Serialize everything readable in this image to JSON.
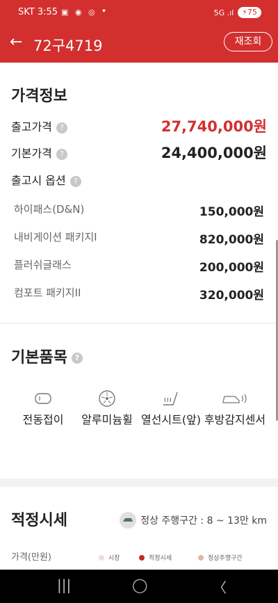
{
  "status": {
    "time": "SKT 3:55",
    "icons": "▣ ◉ ◎",
    "right": "5G .ıl",
    "battery": "75"
  },
  "appbar": {
    "back": "←",
    "title": "72구4719",
    "reload": "재조회"
  },
  "price_info": {
    "heading": "가격정보",
    "release_label": "출고가격",
    "release_value": "27,740,000원",
    "base_label": "기본가격",
    "base_value": "24,400,000원",
    "options_label": "출고시 옵션",
    "options": [
      {
        "label": "하이패스(D&N)",
        "value": "150,000원"
      },
      {
        "label": "내비게이션 패키지I",
        "value": "820,000원"
      },
      {
        "label": "플러쉬글래스",
        "value": "200,000원"
      },
      {
        "label": "컴포트 패키지II",
        "value": "320,000원"
      }
    ]
  },
  "basic_items": {
    "heading": "기본품목",
    "items": [
      {
        "label": "전동접이",
        "icon": "side-mirror-icon"
      },
      {
        "label": "알루미늄휠",
        "icon": "wheel-icon"
      },
      {
        "label": "열선시트(앞)",
        "icon": "heated-seat-icon"
      },
      {
        "label": "후방감지센서",
        "icon": "rear-sensor-icon"
      }
    ]
  },
  "fair_price": {
    "heading": "적정시세",
    "range_text": "정상 주행구간 : 8 ~ 13만 km",
    "ylabel": "가격(만원)",
    "legend": [
      "시장",
      "적정시세",
      "정상주행구간"
    ],
    "legend_colors": [
      "#f2dcd7",
      "#c62828",
      "#e0b5a8"
    ]
  },
  "navbar": {
    "recent": "|||",
    "home": "◯",
    "back": "〈"
  },
  "colors": {
    "accent": "#d32f2f"
  }
}
